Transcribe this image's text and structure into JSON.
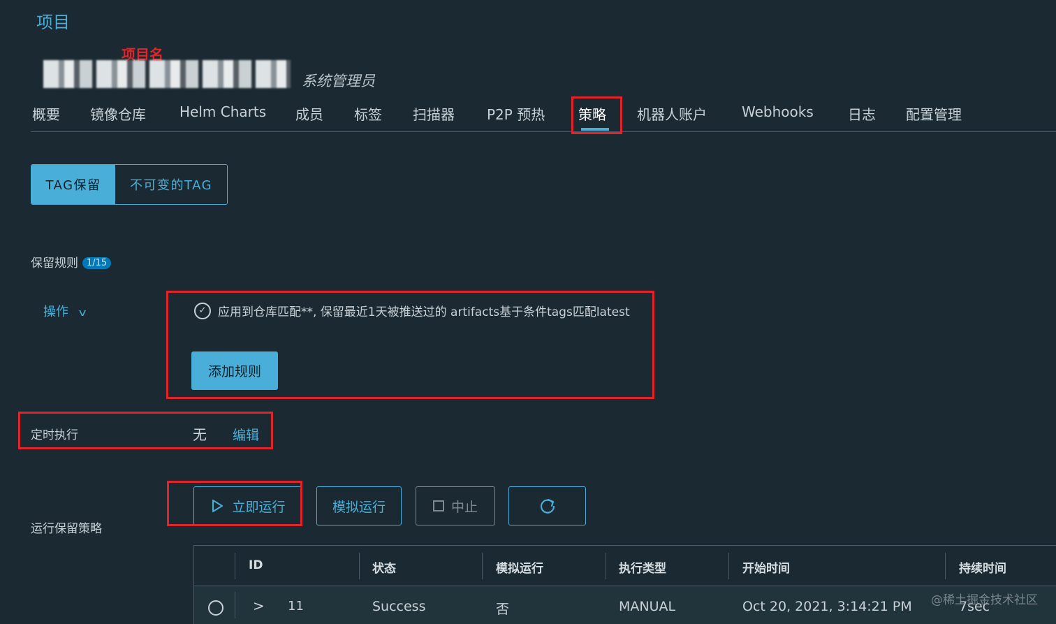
{
  "breadcrumb": "项目",
  "annotation_project_name": "项目名",
  "project": {
    "role": "系统管理员"
  },
  "tabs": [
    {
      "label": "概要"
    },
    {
      "label": "镜像仓库"
    },
    {
      "label": "Helm Charts"
    },
    {
      "label": "成员"
    },
    {
      "label": "标签"
    },
    {
      "label": "扫描器"
    },
    {
      "label": "P2P 预热"
    },
    {
      "label": "策略",
      "active": true
    },
    {
      "label": "机器人账户"
    },
    {
      "label": "Webhooks"
    },
    {
      "label": "日志"
    },
    {
      "label": "配置管理"
    }
  ],
  "policy_tabs": {
    "tag_retention": "TAG保留",
    "immutable_tag": "不可变的TAG",
    "selected": "TAG保留"
  },
  "retention": {
    "label": "保留规则",
    "count_badge": "1/15",
    "actions_label": "操作",
    "rule_text": "应用到仓库匹配**, 保留最近1天被推送过的 artifacts基于条件tags匹配latest",
    "add_rule_label": "添加规则"
  },
  "schedule": {
    "label": "定时执行",
    "value": "无",
    "edit_label": "编辑"
  },
  "run": {
    "label": "运行保留策略",
    "run_now": "立即运行",
    "dry_run": "模拟运行",
    "abort": "中止",
    "refresh_icon": "refresh-icon"
  },
  "table": {
    "columns": [
      "ID",
      "状态",
      "模拟运行",
      "执行类型",
      "开始时间",
      "持续时间"
    ],
    "rows": [
      {
        "id": "11",
        "status": "Success",
        "dry_run": "否",
        "type": "MANUAL",
        "start": "Oct 20, 2021, 3:14:21 PM",
        "duration": "7sec"
      }
    ]
  },
  "watermark": "@稀土掘金技术社区",
  "colors": {
    "background": "#1b2a32",
    "accent": "#49afd9",
    "annotation": "#e0242a"
  }
}
